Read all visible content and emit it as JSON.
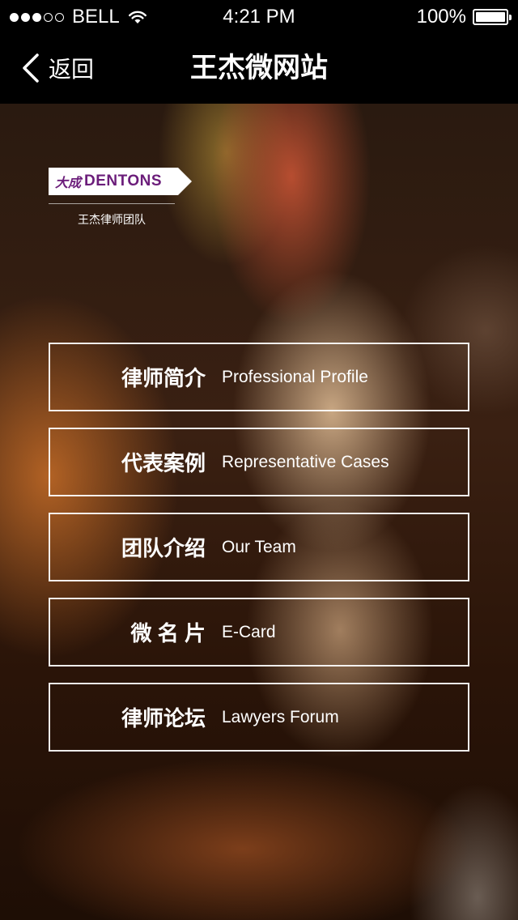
{
  "status_bar": {
    "carrier": "BELL",
    "time": "4:21 PM",
    "battery": "100%",
    "signal_full_dots": 3,
    "signal_empty_dots": 2,
    "battery_level": 1.0
  },
  "nav": {
    "back_label": "返回",
    "title": "王杰微网站"
  },
  "logo": {
    "brand_cn": "大成",
    "brand_en": "DENTONS",
    "team": "王杰律师团队",
    "brand_color": "#6b1d7a"
  },
  "menu": {
    "items": [
      {
        "cn": "律师简介",
        "en": "Professional Profile"
      },
      {
        "cn": "代表案例",
        "en": "Representative Cases"
      },
      {
        "cn": "团队介绍",
        "en": "Our Team"
      },
      {
        "cn": "微 名 片",
        "en": "E-Card"
      },
      {
        "cn": "律师论坛",
        "en": "Lawyers Forum"
      }
    ]
  }
}
